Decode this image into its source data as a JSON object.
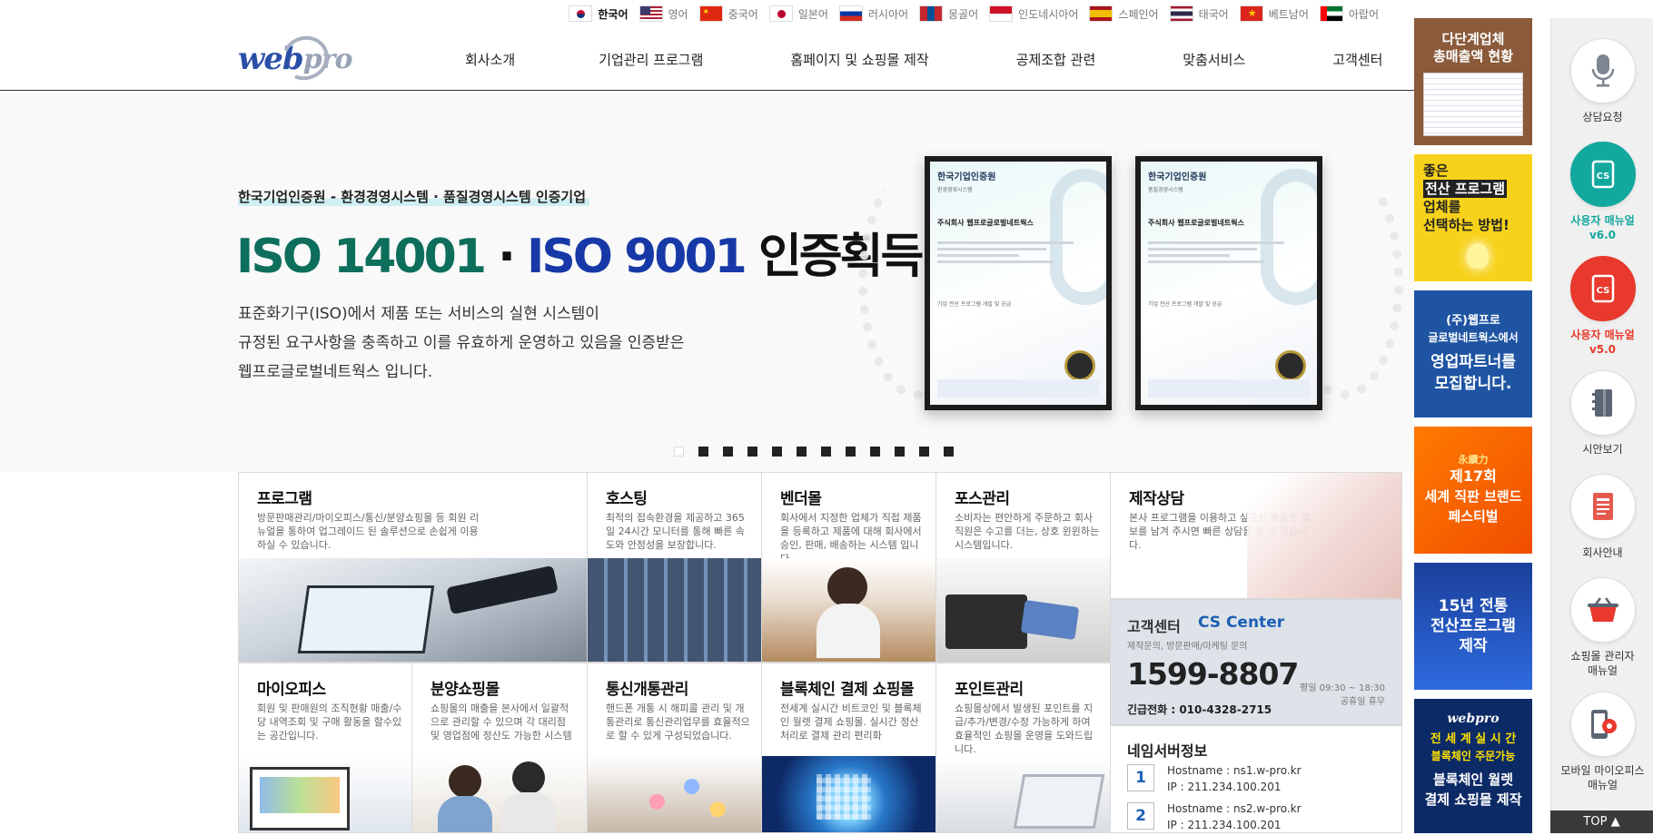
{
  "languages": [
    {
      "label": "한국어",
      "flag": "kr-flag-icon",
      "active": true
    },
    {
      "label": "영어",
      "flag": "us-flag-icon"
    },
    {
      "label": "중국어",
      "flag": "cn-flag-icon"
    },
    {
      "label": "일본어",
      "flag": "jp-flag-icon"
    },
    {
      "label": "러시아어",
      "flag": "ru-flag-icon"
    },
    {
      "label": "몽골어",
      "flag": "mn-flag-icon"
    },
    {
      "label": "인도네시아어",
      "flag": "id-flag-icon"
    },
    {
      "label": "스페인어",
      "flag": "es-flag-icon"
    },
    {
      "label": "태국어",
      "flag": "th-flag-icon"
    },
    {
      "label": "베트남어",
      "flag": "vn-flag-icon"
    },
    {
      "label": "아랍어",
      "flag": "ae-flag-icon"
    }
  ],
  "header": {
    "logo_web": "web",
    "logo_pro": "pro",
    "nav": [
      "회사소개",
      "기업관리 프로그램",
      "홈페이지 및 쇼핑몰 제작",
      "공제조합 관련",
      "맞춤서비스",
      "고객센터"
    ]
  },
  "hero": {
    "subtitle": "한국기업인증원 - 환경경영시스템 · 품질경영시스템 인증기업",
    "title_part1": "ISO 14001",
    "title_dot": "·",
    "title_part2": "ISO 9001",
    "title_part3": "인증획득",
    "description": [
      "표준화기구(ISO)에서 제품 또는 서비스의 실현 시스템이",
      "규정된 요구사항을 충족하고 이를 유효하게 운영하고 있음을 인증받은",
      "웹프로글로벌네트웍스 입니다."
    ],
    "certificates": [
      {
        "org": "한국기업인증원",
        "kind": "환경경영시스템",
        "company": "주식회사 웹프로글로벌네트웍스",
        "scope": "기업 전산 프로그램 개발 및 공급"
      },
      {
        "org": "한국기업인증원",
        "kind": "품질경영시스템",
        "company": "주식회사 웹프로글로벌네트웍스",
        "scope": "기업 전산 프로그램 개발 및 공급"
      }
    ],
    "slide_count": 12,
    "active_slide": 0
  },
  "services": [
    {
      "title": "프로그램",
      "desc": "방문판매관리/마이오피스/통신/분양쇼핑몰 등 회원 리뉴얼을 통하여 업그레이드 된 솔루션으로 손쉽게 이용하실 수 있습니다."
    },
    {
      "title": "호스팅",
      "desc": "최적의 접속환경을 제공하고 365일 24시간 모니터를 통해 빠른 속도와 안정성을 보장합니다."
    },
    {
      "title": "벤더몰",
      "desc": "회사에서 지정한 업체가 직접 제품을 등록하고 제품에 대해 회사에서 승인, 판매, 배송하는 시스템 입니다."
    },
    {
      "title": "포스관리",
      "desc": "소비자는 편안하게 주문하고 회사 직원은 수고를 더는, 상호 윈윈하는 시스템입니다."
    },
    {
      "title": "제작상담",
      "desc": "본사 프로그램을 이용하고 싶으신 분들은 정보를 남겨 주시면 빠른 상담을 할 수 있습니다."
    },
    {
      "title": "마이오피스",
      "desc": "회원 및 판매원의 조직현황 매출/수당 내역조회 및 구매 활동을 할수있는 공간입니다."
    },
    {
      "title": "분양쇼핑몰",
      "desc": "쇼핑몰의 매출을 본사에서 일괄적으로 관리할 수 있으며 각 대리점 및 영업점에 정산도 가능한 시스템"
    },
    {
      "title": "통신개통관리",
      "desc": "핸드폰 개통 시 해피콜 관리 및 개통관리로 통신관리업무를 효율적으로 할 수 있게 구성되었습니다."
    },
    {
      "title": "블록체인 결제 쇼핑몰",
      "desc": "전세계 실시간 비트코인 및 블록체인 월렛 결제 쇼핑몰. 실시간 정산처리로 결제 관리 편리화"
    },
    {
      "title": "포인트관리",
      "desc": "쇼핑몰상에서 발생된 포인트를 지급/추가/변경/수정 가능하게 하여 효율적인 쇼핑몰 운영을 도와드립니다."
    }
  ],
  "cs": {
    "title": "고객센터",
    "title_en": "CS Center",
    "subtitle": "제작문의, 방문판매/마케팅 문의",
    "phone": "1599-8807",
    "hours": "평일 09:30 ~ 18:30",
    "holiday": "공휴일 휴무",
    "emergency": "긴급전화 : 010-4328-2715"
  },
  "nameserver": {
    "title": "네임서버정보",
    "servers": [
      {
        "no": "1",
        "host_label": "Hostname :",
        "host": "ns1.w-pro.kr",
        "ip_label": "IP :",
        "ip": "211.234.100.201"
      },
      {
        "no": "2",
        "host_label": "Hostname :",
        "host": "ns2.w-pro.kr",
        "ip_label": "IP :",
        "ip": "211.234.100.201"
      }
    ]
  },
  "banners": [
    {
      "line1": "다단계업체",
      "line2": "총매출액 현황"
    },
    {
      "line1": "좋은",
      "line2": "전산 프로그램",
      "line3": "업체를",
      "line4": "선택하는 방법!"
    },
    {
      "line1": "(주)웹프로",
      "line2": "글로벌네트웍스에서",
      "line3": "영업파트너를",
      "line4": "모집합니다."
    },
    {
      "line0": "永續力",
      "line1": "제17회",
      "line2": "세계 직판 브랜드",
      "line3": "페스티벌"
    },
    {
      "line1": "15년 전통",
      "line2": "전산프로그램",
      "line3": "제작"
    },
    {
      "logo": "webpro",
      "line1": "전 세 계  실 시 간",
      "line2": "블록체인 주문가능",
      "line3": "블록체인 월렛",
      "line4": "결제 쇼핑몰 제작"
    }
  ],
  "quick_menu": [
    {
      "label": "상담요청",
      "icon": "microphone-icon",
      "accent": false
    },
    {
      "label": "사용자 매뉴얼",
      "label2": "v6.0",
      "icon": "cs-book-icon",
      "accent": "#13a89e"
    },
    {
      "label": "사용자 매뉴얼",
      "label2": "v5.0",
      "icon": "cs-book-icon",
      "accent": "#e8392c"
    },
    {
      "label": "시안보기",
      "icon": "notebook-icon",
      "accent": false
    },
    {
      "label": "회사안내",
      "icon": "document-icon",
      "accent": false
    },
    {
      "label": "쇼핑몰 관리자",
      "label2": "매뉴얼",
      "icon": "basket-icon",
      "accent": false
    },
    {
      "label": "모바일 마이오피스",
      "label2": "매뉴얼",
      "icon": "mobile-gear-icon",
      "accent": false
    }
  ],
  "top_button": "TOP ▲",
  "colors": {
    "green": "#0e6e5c",
    "blue": "#1739a8",
    "cs_blue": "#1d5fb5",
    "teal": "#13a89e",
    "red": "#e8392c"
  }
}
